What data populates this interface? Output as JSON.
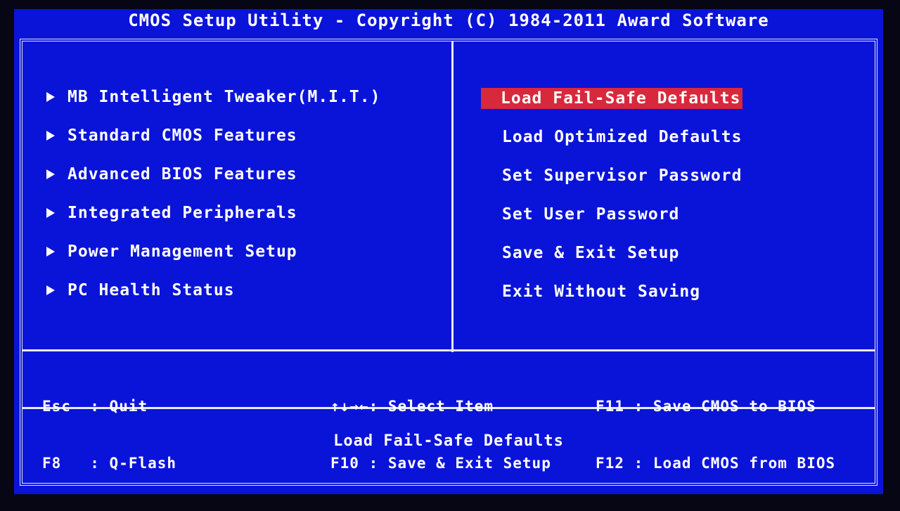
{
  "title": "CMOS Setup Utility - Copyright (C) 1984-2011 Award Software",
  "left_menu": [
    "MB Intelligent Tweaker(M.I.T.)",
    "Standard CMOS Features",
    "Advanced BIOS Features",
    "Integrated Peripherals",
    "Power Management Setup",
    "PC Health Status"
  ],
  "right_menu": [
    "Load Fail-Safe Defaults",
    "Load Optimized Defaults",
    "Set Supervisor Password",
    "Set User Password",
    "Save & Exit Setup",
    "Exit Without Saving"
  ],
  "selected_item": "Load Fail-Safe Defaults",
  "keys": {
    "esc": {
      "key": "Esc",
      "sep": ":",
      "action": "Quit"
    },
    "f8": {
      "key": "F8",
      "sep": ":",
      "action": "Q-Flash"
    },
    "arrows": {
      "key": "↑↓→←",
      "sep": ":",
      "action": "Select Item"
    },
    "f10": {
      "key": "F10",
      "sep": ":",
      "action": "Save & Exit Setup"
    },
    "f11": {
      "key": "F11",
      "sep": ":",
      "action": "Save CMOS to BIOS"
    },
    "f12": {
      "key": "F12",
      "sep": ":",
      "action": "Load CMOS from BIOS"
    }
  },
  "status_text": "Load Fail-Safe Defaults",
  "colors": {
    "background": "#0a14d8",
    "highlight": "#d8283c",
    "text": "#ffffff"
  }
}
